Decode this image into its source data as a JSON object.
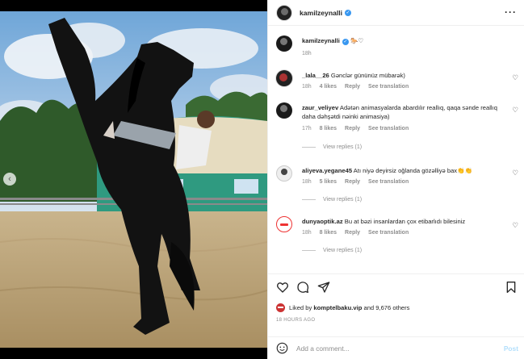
{
  "post": {
    "username": "kamilzeynalli",
    "caption_emoji": "🐎♡",
    "caption_time": "18h",
    "colors": {
      "accent": "#3897f0",
      "post_disabled": "#b2dffc",
      "muted": "#8e8e8e"
    }
  },
  "comments": [
    {
      "user": "_lala__26",
      "text": "Gənclər gününüz mübarək)",
      "time": "18h",
      "likes": "4 likes",
      "reply": "Reply",
      "see_translation": "See translation",
      "avatar": "dark-avatar"
    },
    {
      "user": "zaur_veliyev",
      "text": "Adətən animasyalarda abardılır reallıq, qaqa sənde reallıq daha dəhşətdi nəinki animasiya)",
      "time": "17h",
      "likes": "8 likes",
      "reply": "Reply",
      "see_translation": "See translation",
      "view_replies": "View replies (1)",
      "avatar": "dark-avatar"
    },
    {
      "user": "aliyeva.yegane45",
      "text": "Atı niyə deyirsiz oğlanda gözəlliyə bax👏👏",
      "time": "18h",
      "likes": "5 likes",
      "reply": "Reply",
      "see_translation": "See translation",
      "view_replies": "View replies (1)",
      "avatar": "light-avatar"
    },
    {
      "user": "dunyaoptik.az",
      "text": "Bu at bəzi insanlardan çox etibarlıdı bilesiniz",
      "time": "18h",
      "likes": "8 likes",
      "reply": "Reply",
      "see_translation": "See translation",
      "view_replies": "View replies (1)",
      "avatar": "logo-avatar"
    }
  ],
  "likes": {
    "prefix": "Liked by",
    "user": "komptelbaku.vip",
    "suffix": "and 9,676 others"
  },
  "timestamp": "18 HOURS AGO",
  "add_comment": {
    "placeholder": "Add a comment...",
    "post_label": "Post"
  },
  "icons": {
    "more": "more-options-icon",
    "like": "heart-icon",
    "comment": "comment-icon",
    "share": "share-icon",
    "save": "bookmark-icon",
    "emoji": "emoji-icon",
    "verified": "verified-badge-icon",
    "carousel_prev": "chevron-left-icon"
  }
}
